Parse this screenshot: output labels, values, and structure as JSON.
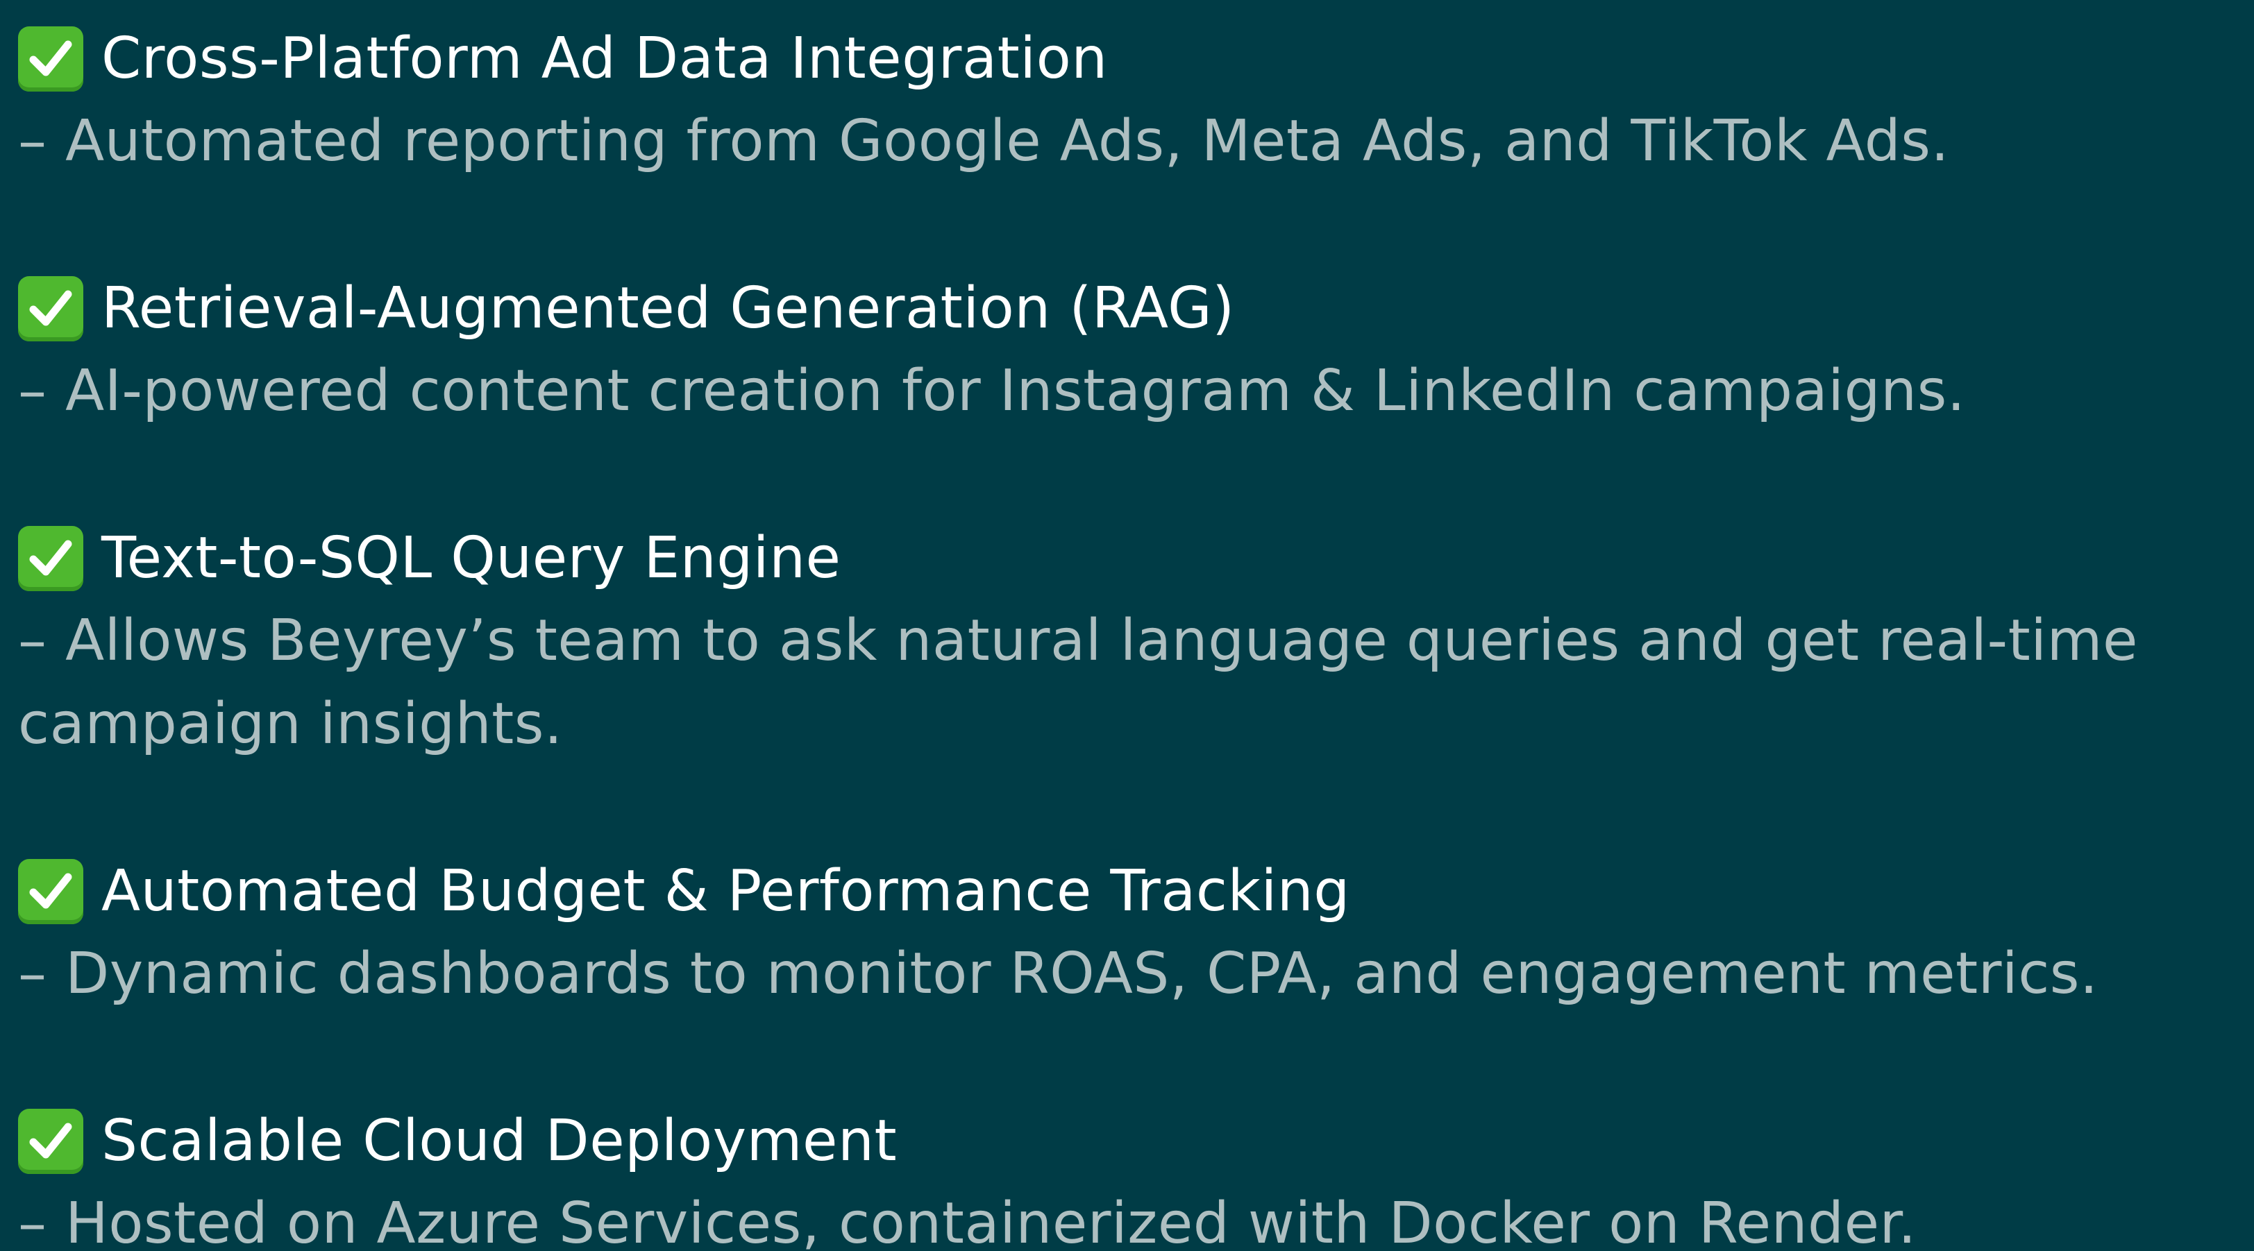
{
  "features": [
    {
      "icon": "check-mark-icon",
      "title": "Cross-Platform Ad Data Integration",
      "description": "– Automated reporting from Google Ads, Meta Ads, and TikTok Ads."
    },
    {
      "icon": "check-mark-icon",
      "title": "Retrieval-Augmented Generation (RAG)",
      "description": "– AI-powered content creation for Instagram & LinkedIn campaigns."
    },
    {
      "icon": "check-mark-icon",
      "title": "Text-to-SQL Query Engine",
      "description": "– Allows Beyrey’s team to ask natural language queries and get real-time campaign insights."
    },
    {
      "icon": "check-mark-icon",
      "title": "Automated Budget & Performance Tracking",
      "description": "– Dynamic dashboards to monitor ROAS, CPA, and engagement metrics."
    },
    {
      "icon": "check-mark-icon",
      "title": "Scalable Cloud Deployment",
      "description": "– Hosted on Azure Services, containerized with Docker on Render."
    }
  ],
  "colors": {
    "background": "#003c46",
    "title_text": "#ffffff",
    "description_text": "#aebfc1",
    "check_box": "#4fb82f"
  }
}
